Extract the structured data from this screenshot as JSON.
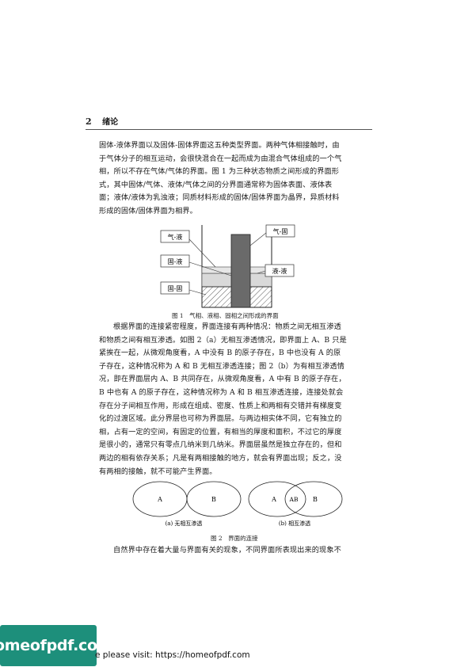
{
  "header": {
    "page_number": "2",
    "chapter": "绪论"
  },
  "paragraph1": [
    "固体-液体界面以及固体-固体界面这五种类型界面。两种气体相接触时，由",
    "于气体分子的相互运动，会很快混合在一起而成为由混合气体组成的一个气",
    "相，所以不存在气体/气体的界面。图 1 为三种状态物质之间形成的界面形",
    "式，其中固体/气体、液体/气体之间的分界面通常称为固体表面、液体表",
    "面；液体/液体为乳浊液；同质材料形成的固体/固体界面为晶界，异质材料",
    "形成的固体/固体界面为相界。"
  ],
  "figure1": {
    "labels": {
      "gas_liquid": "气-液",
      "gas_solid": "气-固",
      "solid_liquid": "固-液",
      "liquid_liquid": "液-液",
      "solid_solid": "固-固"
    },
    "caption": "图 1　气相、液相、固相之间形成的界面"
  },
  "paragraph2": [
    "根据界面的连接紧密程度，界面连接有两种情况：物质之间无相互渗透",
    "和物质之间有相互渗透。如图 2（a）无相互渗透情况，即界面上 A、B 只是",
    "紧挨在一起，从微观角度看，A 中没有 B 的原子存在，B 中也没有 A 的原",
    "子存在，这种情况称为 A 和 B 无相互渗透连接；图 2（b）为有相互渗透情",
    "况，即在界面层内 A、B 共同存在，从微观角度看，A 中有 B 的原子存在，",
    "B 中也有 A 的原子存在，这种情况称为 A 和 B 相互渗透连接，连接处就会",
    "存在分子间相互作用，形成在组成、密度、性质上和两相有交错并有梯度变",
    "化的过渡区域。此分界层也可称为界面层。与两边相实体不同，它有独立的",
    "相，占有一定的空间，有固定的位置，有相当的厚度和面积，不过它的厚度",
    "是很小的，通常只有零点几纳米到几纳米。界面层虽然是独立存在的，但和",
    "两边的相有依存关系；凡是有两相接触的地方，就会有界面出现；反之，没",
    "有两相的接触，就不可能产生界面。"
  ],
  "figure2": {
    "left": {
      "a": "A",
      "b": "B",
      "sub": "(a) 无相互渗透"
    },
    "right": {
      "a": "A",
      "ab": "AB",
      "b": "B",
      "sub": "(b) 相互渗透"
    },
    "caption": "图 2　界面的连接"
  },
  "paragraph3": [
    "自然界中存在着大量与界面有关的现象，不同界面所表现出来的现象不"
  ],
  "footer": {
    "logo": "homeofpdf.com",
    "text": "e please visit: https://homeofpdf.com"
  }
}
